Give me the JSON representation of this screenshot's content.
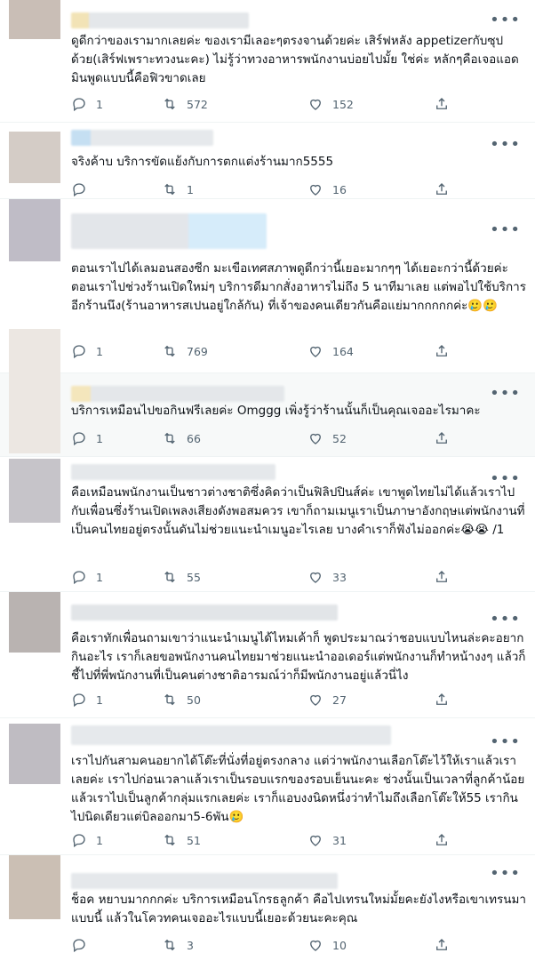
{
  "more_label": "•••",
  "tweets": [
    {
      "text": "ดูดีกว่าของเรามากเลยค่ะ ของเรามีเลอะๆตรงจานด้วยค่ะ เสิร์ฟหลัง appetizerกับซุปด้วย(เสิร์ฟเพราะทวงนะคะ) ไม่รู้ว่าทวงอาหารพนักงานบ่อยไปมั้ย ใช่ค่ะ หลักๆคือเจอแอดมินพูดแบบนี้คือฟิวขาดเลย",
      "replies": "1",
      "retweets": "572",
      "likes": "152"
    },
    {
      "text": "จริงค้าบ บริการขัดแย้งกับการตกแต่งร้านมาก5555",
      "replies": "",
      "retweets": "1",
      "likes": "16"
    },
    {
      "text": "ตอนเราไปได้เลมอนสองซีก มะเขือเทศสภาพดูดีกว่านี้เยอะมากๆๆ ได้เยอะกว่านี้ด้วยค่ะ ตอนเราไปช่วงร้านเปิดใหม่ๆ บริการดีมากสั่งอาหารไม่ถึง 5 นาทีมาเลย แต่พอไปใช้บริการอีกร้านนึง(ร้านอาหารสเปนอยู่ใกล้กัน) ที่เจ้าของคนเดียวกันคือแย่มากกกกกค่ะ🥲🥲",
      "replies": "1",
      "retweets": "769",
      "likes": "164"
    },
    {
      "text": "บริการเหมือนไปขอกินฟรีเลยค่ะ Omggg เพิ่งรู้ว่าร้านนั้นก็เป็นคุณเจออะไรมาคะ",
      "replies": "1",
      "retweets": "66",
      "likes": "52"
    },
    {
      "text": "คือเหมือนพนักงานเป็นชาวต่างชาติซึ่งคิดว่าเป็นฟิลิปปินส์ค่ะ เขาพูดไทยไม่ได้แล้วเราไปกับเพื่อนซึ่งร้านเปิดเพลงเสียงดังพอสมควร เขาก็ถามเมนูเราเป็นภาษาอังกฤษแต่พนักงานที่เป็นคนไทยอยู่ตรงนั้นดันไม่ช่วยแนะนำเมนูอะไรเลย บางคำเราก็ฟังไม่ออกค่ะ😭😭 /1",
      "replies": "1",
      "retweets": "55",
      "likes": "33"
    },
    {
      "text": "คือเราทักเพื่อนถามเขาว่าแนะนำเมนูได้ไหมเค้าก็ พูดประมาณว่าชอบแบบไหนล่ะคะอยากกินอะไร เราก็เลยขอพนักงานคนไทยมาช่วยแนะนำออเดอร์แต่พนักงานก็ทำหน้างงๆ แล้วก็ชี้ไปที่พี่พนักงานที่เป็นคนต่างชาติอารมณ์ว่าก็มีพนักงานอยู่แล้วนี่ไง",
      "replies": "1",
      "retweets": "50",
      "likes": "27"
    },
    {
      "text": "เราไปกันสามคนอยากได้โต๊ะที่นั่งที่อยู่ตรงกลาง แต่ว่าพนักงานเลือกโต๊ะไว้ให้เราแล้วเราเลยค่ะ เราไปก่อนเวลาแล้วเราเป็นรอบแรกของรอบเย็นนะคะ ช่วงนั้นเป็นเวลาที่ลูกค้าน้อยแล้วเราไปเป็นลูกค้ากลุ่มแรกเลยค่ะ เราก็แอบงงนิดหนึ่งว่าทำไมถึงเลือกโต๊ะให้55 เรากินไปนิดเดียวแต่บิลออกมา5-6พัน🥲",
      "replies": "1",
      "retweets": "51",
      "likes": "31"
    },
    {
      "text": "ช็อค หยาบมากกกค่ะ บริการเหมือนโกรธลูกค้า คือไปเทรนใหม่มั้ยคะยังไงหรือเขาเทรนมาแบบนี้ แล้วในโควทคนเจออะไรแบบนี้เยอะด้วยนะคะคุณ",
      "replies": "",
      "retweets": "3",
      "likes": "10"
    }
  ]
}
